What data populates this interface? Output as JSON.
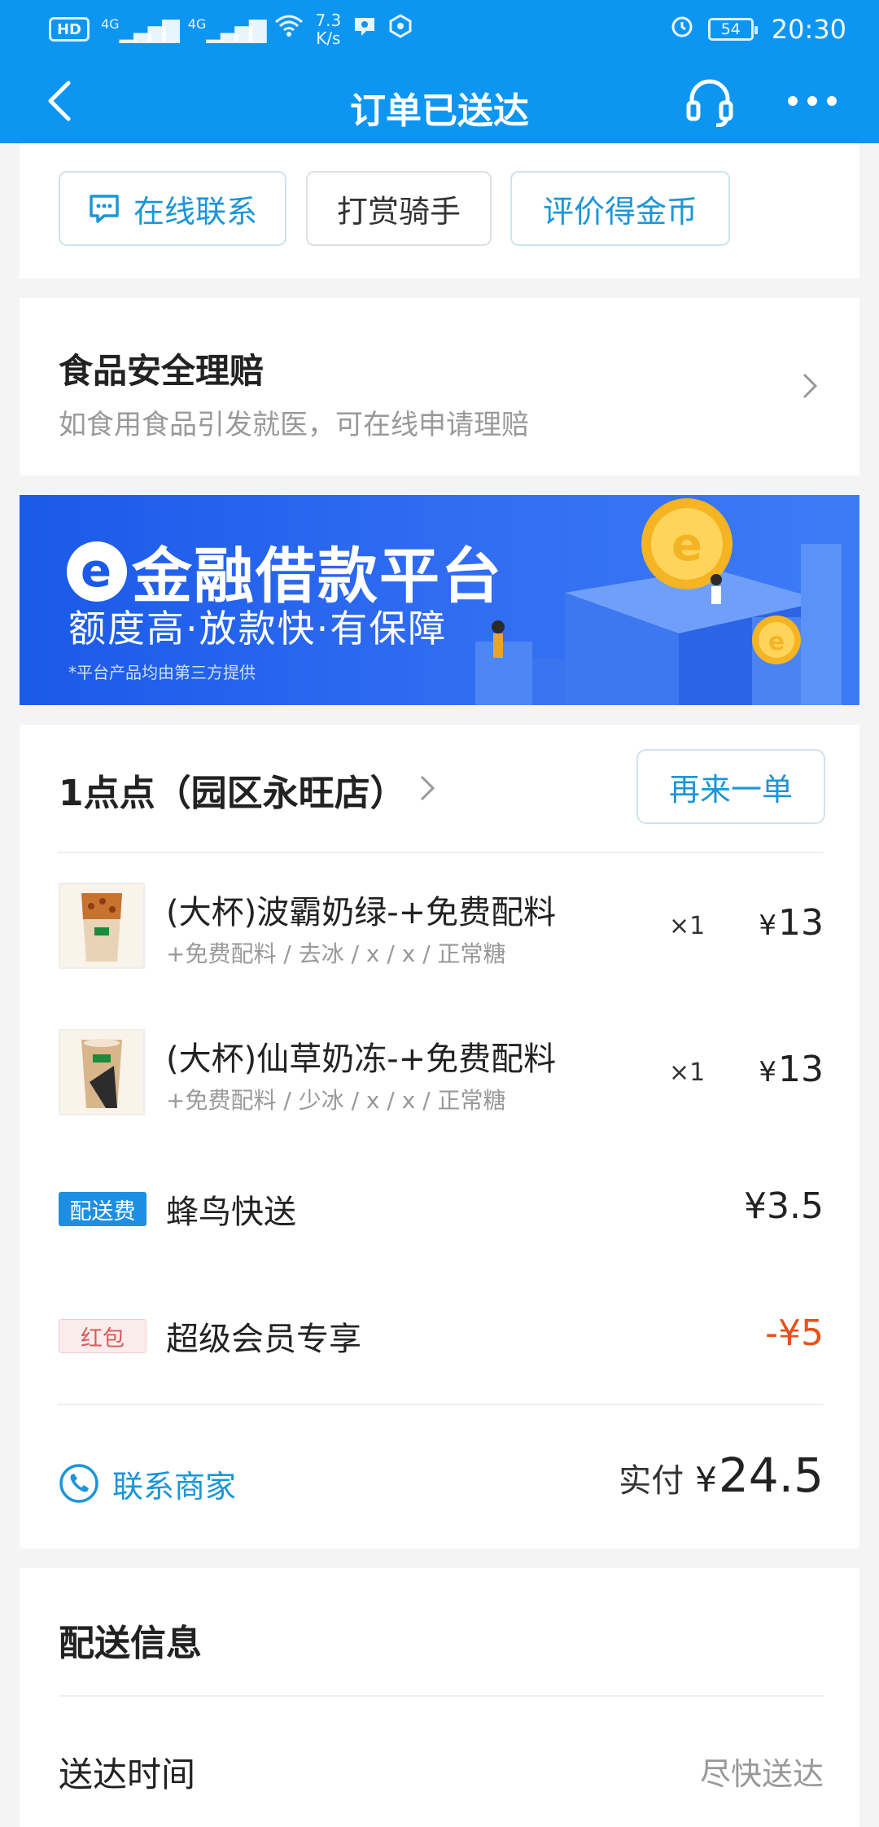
{
  "status_bar": {
    "hd": "HD",
    "signal_1": "4G",
    "signal_2": "4G",
    "speed_value": "7.3",
    "speed_unit": "K/s",
    "battery": "54",
    "time": "20:30"
  },
  "nav": {
    "title": "订单已送达"
  },
  "actions": {
    "online_contact": "在线联系",
    "tip_rider": "打赏骑手",
    "review": "评价得金币"
  },
  "food_safety": {
    "title": "食品安全理赔",
    "subtitle": "如食用食品引发就医，可在线申请理赔"
  },
  "banner": {
    "logo": "e",
    "title": "金融借款平台",
    "subtitle": "额度高·放款快·有保障",
    "note": "*平台产品均由第三方提供"
  },
  "order": {
    "shop_name": "1点点（园区永旺店）",
    "reorder_label": "再来一单",
    "items": [
      {
        "name": "(大杯)波霸奶绿-+免费配料",
        "spec": "+免费配料 / 去冰 / x / x / 正常糖",
        "qty": "×1",
        "currency": "¥",
        "price": "13"
      },
      {
        "name": "(大杯)仙草奶冻-+免费配料",
        "spec": "+免费配料 / 少冰 / x / x / 正常糖",
        "qty": "×1",
        "currency": "¥",
        "price": "13"
      }
    ],
    "delivery_fee": {
      "tag": "配送费",
      "label": "蜂鸟快送",
      "amount": "¥3.5"
    },
    "red_packet": {
      "tag": "红包",
      "label": "超级会员专享",
      "amount": "-¥5"
    },
    "contact_merchant": "联系商家",
    "paid_label": "实付",
    "paid_currency": "¥",
    "paid_amount": "24.5"
  },
  "delivery_info": {
    "title": "配送信息",
    "time_label": "送达时间",
    "time_value": "尽快送达"
  },
  "colors": {
    "header_blue": "#0c96f2",
    "link_blue": "#1b95d8",
    "discount_red": "#e5531a",
    "banner_blue": "#1a5ae8"
  }
}
